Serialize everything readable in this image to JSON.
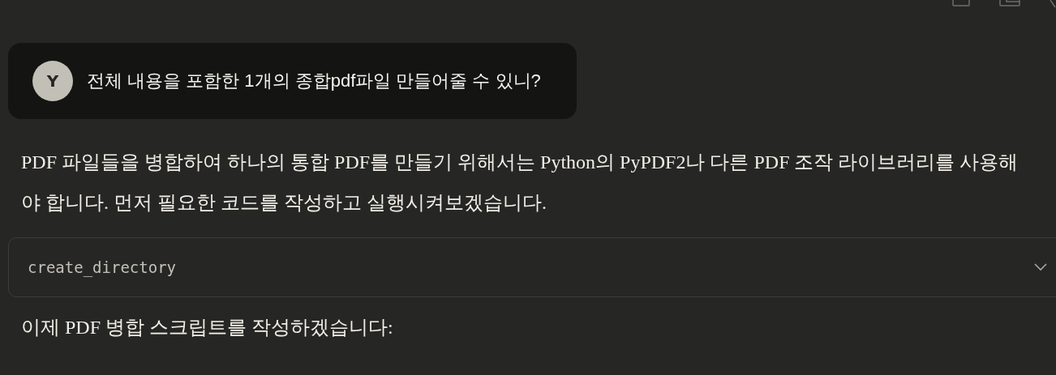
{
  "user_message": {
    "avatar": "Y",
    "text": "전체 내용을 포함한 1개의 종합pdf파일 만들어줄 수 있니?"
  },
  "response": [
    {
      "kind": "paragraph",
      "text": "PDF 파일들을 병합하여 하나의 통합 PDF를 만들기 위해서는 Python의 PyPDF2나 다른 PDF 조작 라이브러리를 사용해야 합니다. 먼저 필요한 코드를 작성하고 실행시켜보겠습니다."
    },
    {
      "kind": "tool",
      "text": "create_directory",
      "expanded": false
    },
    {
      "kind": "paragraph",
      "text": "이제 PDF 병합 스크립트를 작성하겠습니다:"
    }
  ]
}
